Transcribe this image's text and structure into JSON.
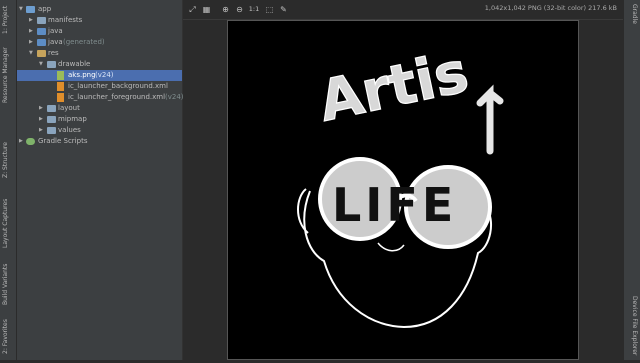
{
  "left_tabs": [
    "1: Project",
    "Resource Manager",
    "Z: Structure",
    "Layout Captures",
    "Build Variants",
    "2: Favorites"
  ],
  "tree": {
    "items": [
      {
        "label": "app",
        "suffix": ""
      },
      {
        "label": "manifests",
        "suffix": ""
      },
      {
        "label": "java",
        "suffix": ""
      },
      {
        "label": "java",
        "suffix": "(generated)"
      },
      {
        "label": "res",
        "suffix": ""
      },
      {
        "label": "drawable",
        "suffix": ""
      },
      {
        "label": "aks.png",
        "suffix": "(v24)"
      },
      {
        "label": "ic_launcher_background.xml",
        "suffix": ""
      },
      {
        "label": "ic_launcher_foreground.xml",
        "suffix": "(v24)"
      },
      {
        "label": "layout",
        "suffix": ""
      },
      {
        "label": "mipmap",
        "suffix": ""
      },
      {
        "label": "values",
        "suffix": ""
      },
      {
        "label": "Gradle Scripts",
        "suffix": ""
      }
    ]
  },
  "toolbar": {
    "zoom_label": "1:1",
    "image_info": "1,042x1,042 PNG (32-bit color) 217.6 kB"
  },
  "image": {
    "text_top": "Artis",
    "text_lenses": "LIFE"
  },
  "right_tabs": [
    "Gradle",
    "Device File Explorer"
  ]
}
